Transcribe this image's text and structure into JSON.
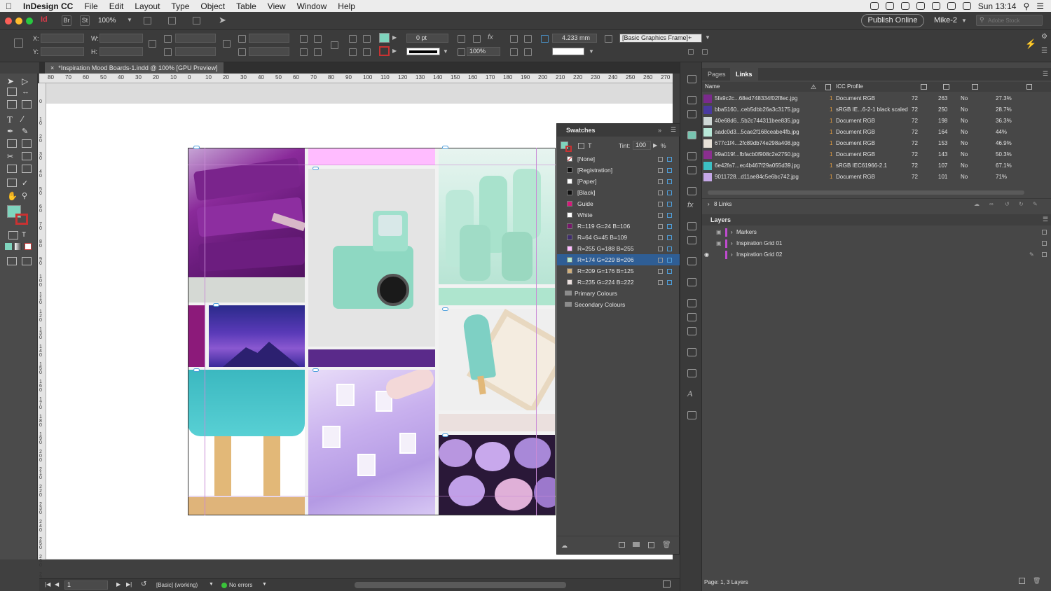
{
  "menubar": {
    "app": "InDesign CC",
    "items": [
      "File",
      "Edit",
      "Layout",
      "Type",
      "Object",
      "Table",
      "View",
      "Window",
      "Help"
    ],
    "clock": "Sun 13:14"
  },
  "appbar": {
    "br_label": "Br",
    "st_label": "St",
    "zoom": "100%",
    "publish": "Publish Online",
    "user": "Mike-2",
    "search_placeholder": "Adobe Stock"
  },
  "control": {
    "x_label": "X:",
    "y_label": "Y:",
    "w_label": "W:",
    "h_label": "H:",
    "stroke_weight": "0 pt",
    "scale": "100%",
    "size_mm": "4.233 mm",
    "object_style": "[Basic Graphics Frame]+"
  },
  "document": {
    "tab_title": "*Inspiration Mood Boards-1.indd @ 100% [GPU Preview]"
  },
  "ruler": {
    "h": [
      "80",
      "70",
      "60",
      "50",
      "40",
      "30",
      "20",
      "10",
      "0",
      "10",
      "20",
      "30",
      "40",
      "50",
      "60",
      "70",
      "80",
      "90",
      "100",
      "110",
      "120",
      "130",
      "140",
      "150",
      "160",
      "170",
      "180",
      "190",
      "200",
      "210",
      "220",
      "230",
      "240",
      "250",
      "260",
      "270"
    ],
    "v": [
      "0",
      "1 0",
      "2 0",
      "3 0",
      "4 0",
      "5 0",
      "6 0",
      "7 0",
      "8 0",
      "9 0",
      "1 0 0",
      "1 1 0",
      "1 2 0",
      "1 3 0",
      "1 4 0",
      "1 5 0",
      "1 6 0",
      "1 7 0",
      "1 8 0",
      "1 9 0",
      "2 0 0",
      "2 1 0",
      "2 2 0",
      "2 3 0",
      "2 4 0",
      "2 5 0",
      "2 6 0",
      "2 7 0"
    ]
  },
  "swatches": {
    "title": "Swatches",
    "tint_label": "Tint:",
    "tint_value": "100",
    "tint_unit": "%",
    "items": [
      {
        "name": "[None]",
        "color": "#ffffff"
      },
      {
        "name": "[Registration]",
        "color": "#111111"
      },
      {
        "name": "[Paper]",
        "color": "#ffffff"
      },
      {
        "name": "[Black]",
        "color": "#111111"
      },
      {
        "name": "Guide",
        "color": "#d6197a"
      },
      {
        "name": "White",
        "color": "#ffffff"
      },
      {
        "name": "R=119 G=24 B=106",
        "color": "#77186a"
      },
      {
        "name": "R=64 G=45 B=109",
        "color": "#402d6d"
      },
      {
        "name": "R=255 G=188 B=255",
        "color": "#ffbcff"
      },
      {
        "name": "R=174 G=229 B=206",
        "color": "#aee5ce",
        "selected": true
      },
      {
        "name": "R=209 G=176 B=125",
        "color": "#d1b07d"
      },
      {
        "name": "R=235 G=224 B=222",
        "color": "#ebe0de"
      }
    ],
    "groups": [
      "Primary Colours",
      "Secondary Colours"
    ]
  },
  "links": {
    "tabs": [
      "Pages",
      "Links"
    ],
    "columns": {
      "name": "Name",
      "icc": "ICC Profile"
    },
    "rows": [
      {
        "name": "5fa9c2c...68ed748334f02f8ec.jpg",
        "icc": "Document RGB",
        "ppi": "72",
        "eff": "263",
        "flag": "No",
        "scale": "27.3%",
        "thumb": "#7a2a8c"
      },
      {
        "name": "bba5160...ceb5dbb26a3c3175.jpg",
        "icc": "sRGB IE...6-2-1 black scaled",
        "ppi": "72",
        "eff": "250",
        "flag": "No",
        "scale": "28.7%",
        "thumb": "#4a3aa0"
      },
      {
        "name": "40e68d6...5b2c744311bee835.jpg",
        "icc": "Document RGB",
        "ppi": "72",
        "eff": "198",
        "flag": "No",
        "scale": "36.3%",
        "thumb": "#cfd8d6"
      },
      {
        "name": "aadc0d3...5cae2f168ceabe4fb.jpg",
        "icc": "Document RGB",
        "ppi": "72",
        "eff": "164",
        "flag": "No",
        "scale": "44%",
        "thumb": "#b8e8d8"
      },
      {
        "name": "677c1f4...2fc89db74e298a408.jpg",
        "icc": "Document RGB",
        "ppi": "72",
        "eff": "153",
        "flag": "No",
        "scale": "46.9%",
        "thumb": "#e8e2d8"
      },
      {
        "name": "99a019f...fbfacb0f908c2e2750.jpg",
        "icc": "Document RGB",
        "ppi": "72",
        "eff": "143",
        "flag": "No",
        "scale": "50.3%",
        "thumb": "#8b2f8f"
      },
      {
        "name": "6e42fa7...ec4b467f29a055d39.jpg",
        "icc": "sRGB IEC61966-2.1",
        "ppi": "72",
        "eff": "107",
        "flag": "No",
        "scale": "67.1%",
        "thumb": "#3cc0c4"
      },
      {
        "name": "9011728...d11ae84c5e6bc742.jpg",
        "icc": "Document RGB",
        "ppi": "72",
        "eff": "101",
        "flag": "No",
        "scale": "71%",
        "thumb": "#c6a8e8"
      }
    ],
    "count": "8 Links"
  },
  "layers": {
    "title": "Layers",
    "items": [
      {
        "name": "Markers",
        "color": "#c04ad0",
        "visible": false,
        "locked": true
      },
      {
        "name": "Inspiration Grid 01",
        "color": "#c04ad0",
        "visible": false,
        "locked": true
      },
      {
        "name": "Inspiration Grid 02",
        "color": "#c04ad0",
        "visible": true,
        "locked": false
      }
    ],
    "footer": "Page: 1, 3 Layers"
  },
  "status": {
    "page": "1",
    "preflight_profile": "[Basic] (working)",
    "errors": "No errors"
  },
  "colors": {
    "accent_mint": "#7fd4bd",
    "stroke_red": "#c83232",
    "guide_magenta": "#c98bd6",
    "selection": "#2f5e95"
  }
}
